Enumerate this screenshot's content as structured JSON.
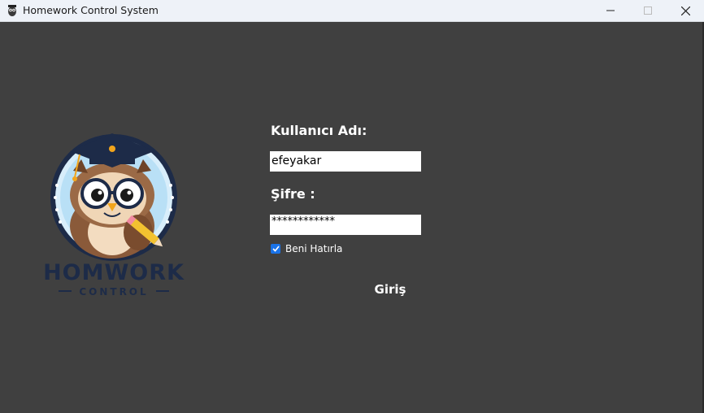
{
  "window": {
    "title": "Homework Control System",
    "app_icon": "owl-icon",
    "controls": [
      "minimize-icon",
      "maximize-icon",
      "close-icon"
    ]
  },
  "logo": {
    "icon": "owl-graduate-logo",
    "text_main": "HOMWORK",
    "text_sub": "CONTROL"
  },
  "form": {
    "username_label": "Kullanıcı Adı:",
    "username_value": "efeyakar",
    "password_label": "Şifre :",
    "password_value": "************",
    "remember_label": "Beni Hatırla",
    "remember_checked": true,
    "login_label": "Giriş"
  },
  "colors": {
    "background": "#404040",
    "titlebar": "#eef2f8",
    "checkbox": "#1a73e8",
    "logo_navy": "#1d2b48"
  }
}
